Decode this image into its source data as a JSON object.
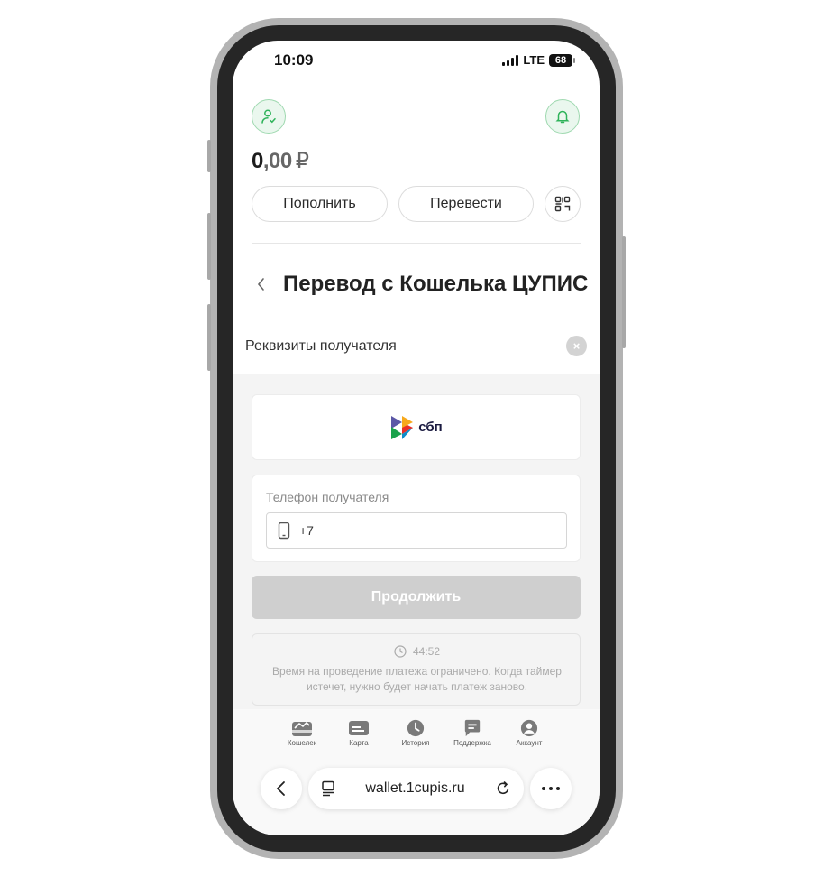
{
  "status_bar": {
    "time": "10:09",
    "network": "LTE",
    "battery": "68"
  },
  "header": {
    "profile_icon": "user-check-icon",
    "bell_icon": "bell-icon",
    "balance_int": "0",
    "balance_frac": ",00",
    "currency": "₽",
    "topup_label": "Пополнить",
    "transfer_label": "Перевести",
    "qr_icon": "qr-scan-icon",
    "accent": "#2fb35a"
  },
  "page": {
    "back_icon": "chevron-left-icon",
    "title": "Перевод с Кошелька ЦУПИС"
  },
  "sheet": {
    "title": "Реквизиты получателя",
    "close_icon": "close-icon"
  },
  "sbp": {
    "logo_text": "сбп"
  },
  "recipient": {
    "label": "Телефон получателя",
    "value": "+7",
    "icon": "phone-icon"
  },
  "continue_label": "Продолжить",
  "timer": {
    "value": "44:52",
    "icon": "clock-icon",
    "note": "Время на проведение платежа ограничено. Когда таймер истечет, нужно будет начать платеж заново."
  },
  "tabs": [
    {
      "label": "Кошелек",
      "icon": "wallet-icon"
    },
    {
      "label": "Карта",
      "icon": "card-icon"
    },
    {
      "label": "История",
      "icon": "clock-icon"
    },
    {
      "label": "Поддержка",
      "icon": "chat-icon"
    },
    {
      "label": "Аккаунт",
      "icon": "account-icon"
    }
  ],
  "browser": {
    "url": "wallet.1cupis.ru",
    "back_icon": "chevron-left-icon",
    "reload_icon": "reload-icon",
    "more_icon": "more-icon"
  }
}
